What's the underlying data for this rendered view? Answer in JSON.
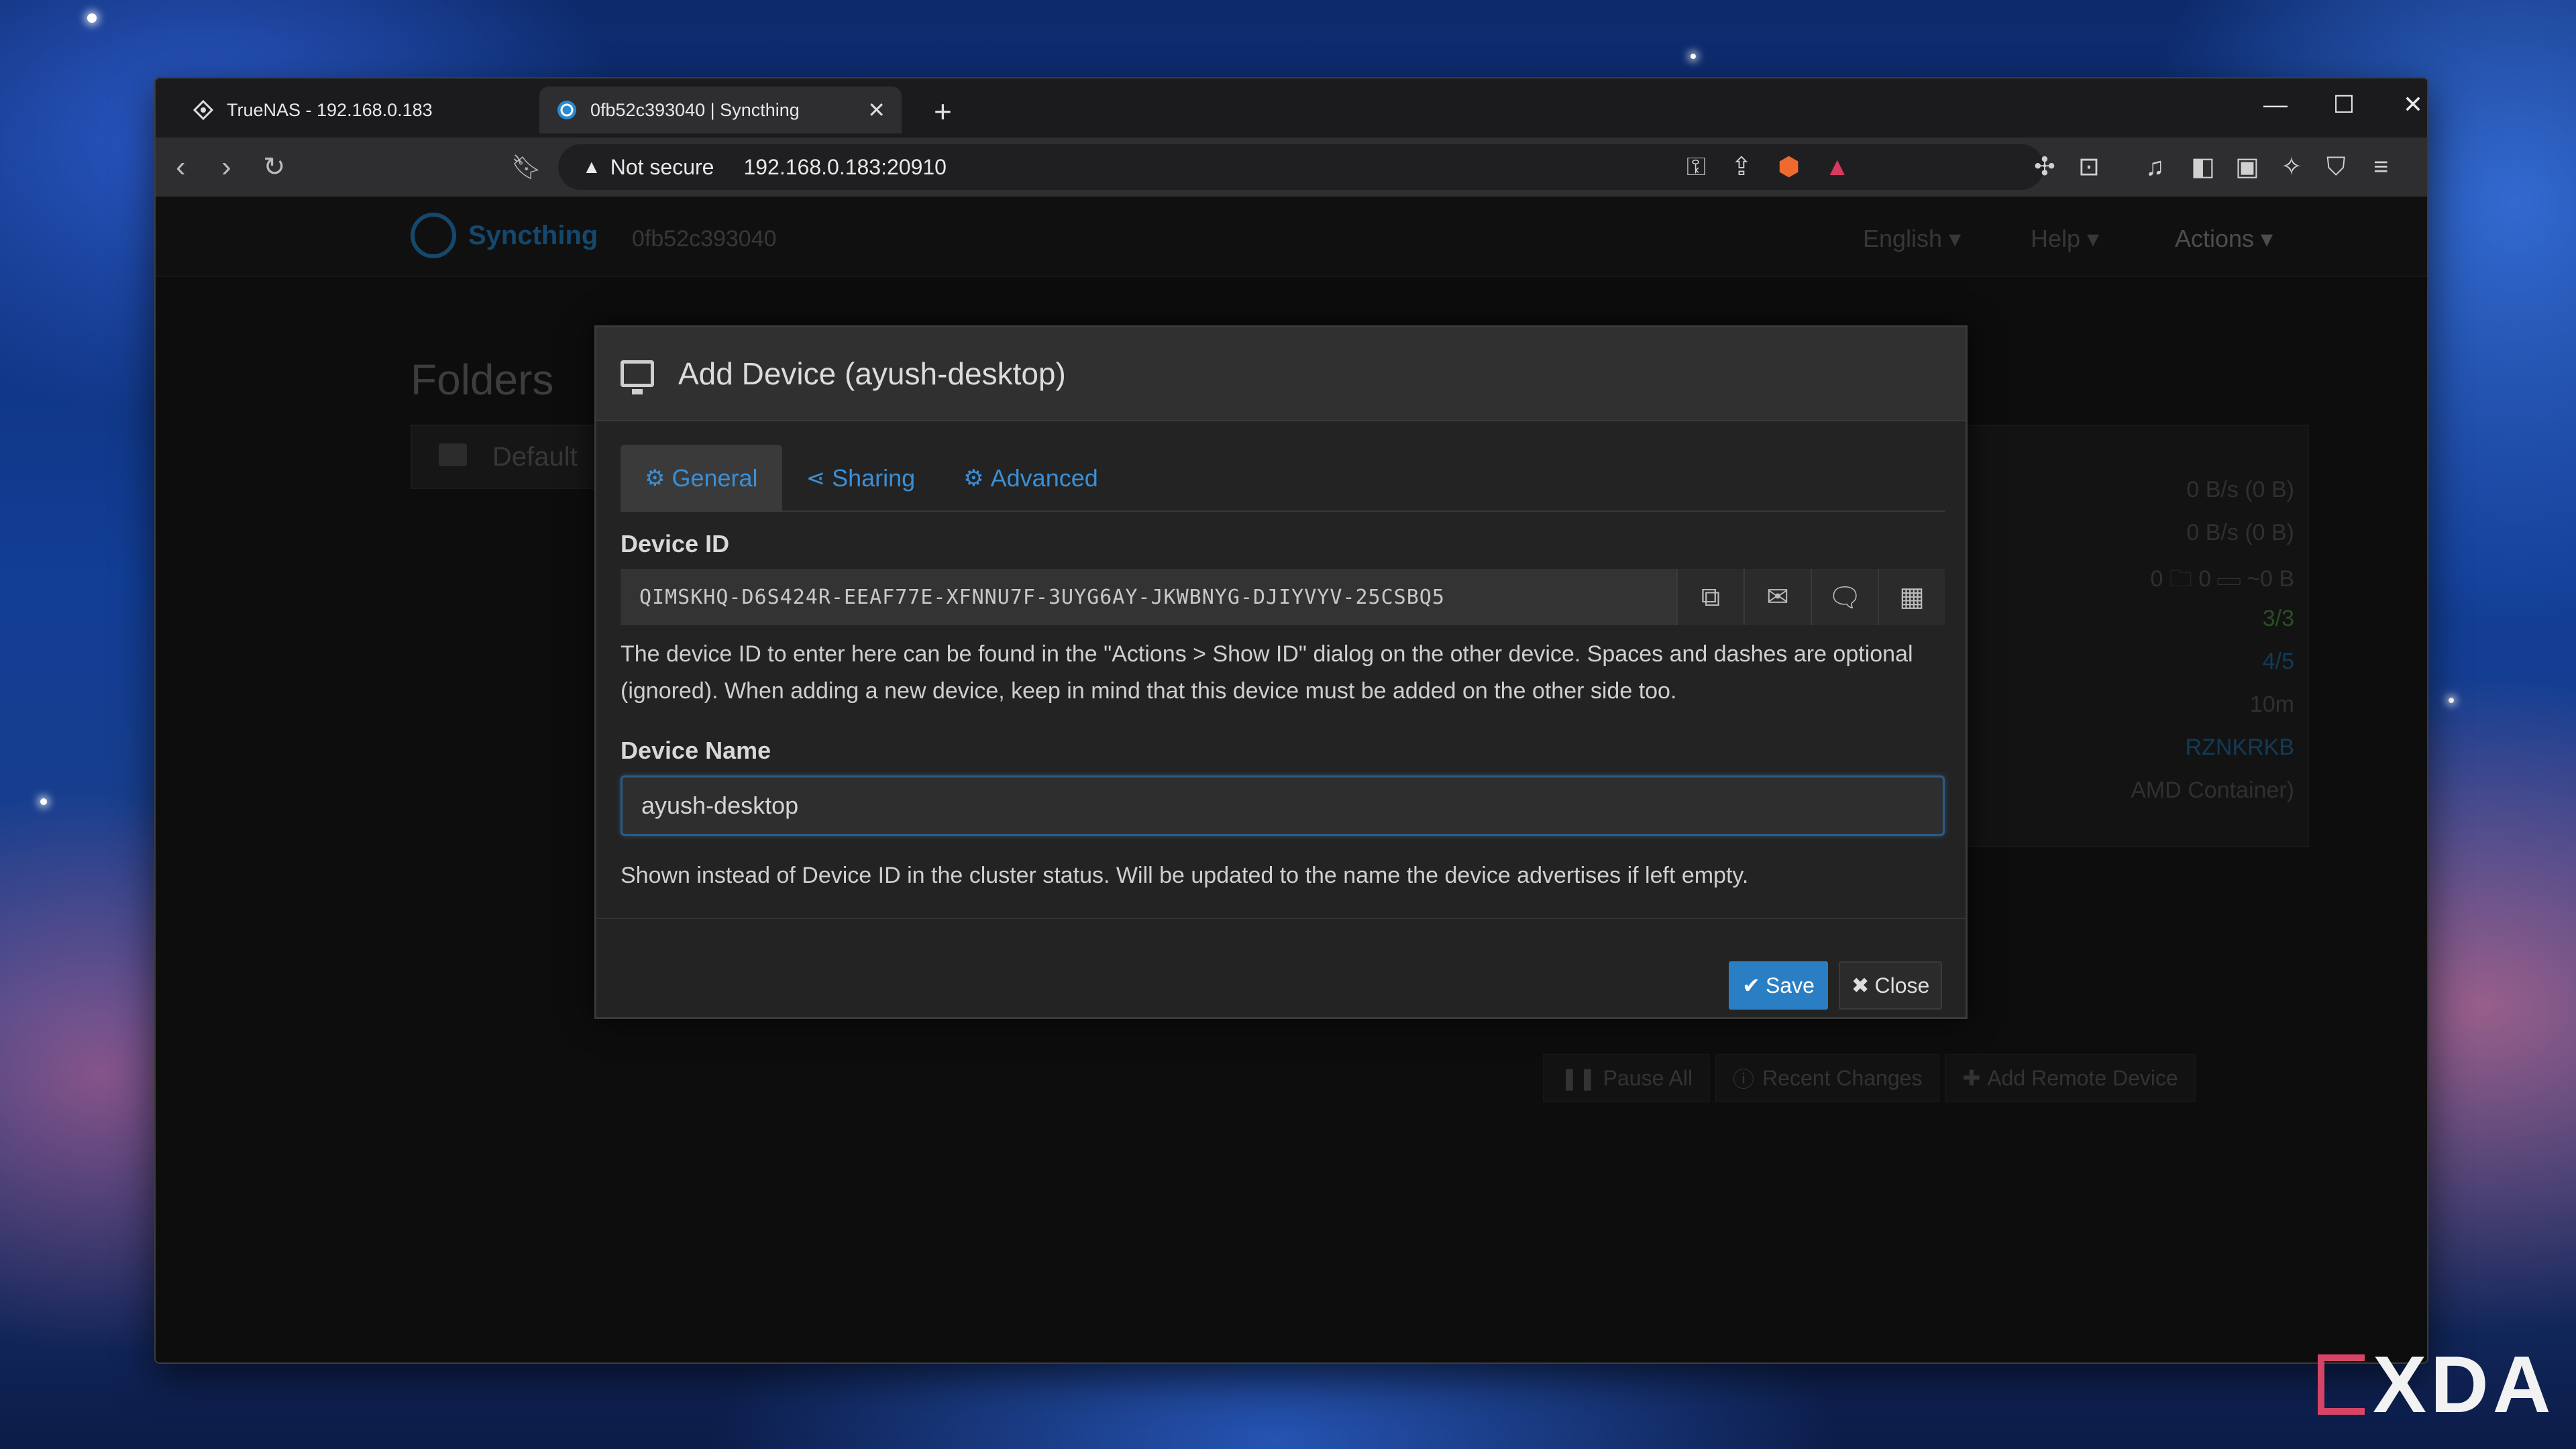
{
  "browser": {
    "tabs": [
      {
        "title": "TrueNAS - 192.168.0.183",
        "active": false
      },
      {
        "title": "0fb52c393040 | Syncthing",
        "active": true
      }
    ],
    "url": {
      "security_label": "Not secure",
      "address": "192.168.0.183:20910"
    }
  },
  "syncthing": {
    "brand": "Syncthing",
    "device_id_short": "0fb52c393040",
    "nav": {
      "language": "English ▾",
      "help": "Help ▾",
      "actions": "Actions ▾"
    },
    "folders_title": "Folders",
    "folder_name": "Default",
    "device_rows": [
      "0 B/s (0 B)",
      "0 B/s (0 B)",
      "0  🗀 0  ▭ ~0 B",
      "3/3",
      "4/5",
      "10m",
      "RZNKRKB",
      "AMD Container)"
    ],
    "bottom_buttons": {
      "pause_all": "Pause All",
      "recent_changes": "Recent Changes",
      "add_remote_device": "Add Remote Device"
    }
  },
  "modal": {
    "title": "Add Device (ayush-desktop)",
    "tabs": {
      "general": "General",
      "sharing": "Sharing",
      "advanced": "Advanced"
    },
    "device_id_label": "Device ID",
    "device_id_value": "QIMSKHQ-D6S424R-EEAF77E-XFNNU7F-3UYG6AY-JKWBNYG-DJIYVYV-25CSBQ5",
    "device_id_help": "The device ID to enter here can be found in the \"Actions > Show ID\" dialog on the other device. Spaces and dashes are optional (ignored). When adding a new device, keep in mind that this device must be added on the other side too.",
    "device_name_label": "Device Name",
    "device_name_value": "ayush-desktop",
    "device_name_help": "Shown instead of Device ID in the cluster status. Will be updated to the name the device advertises if left empty.",
    "save_label": "Save",
    "close_label": "Close"
  },
  "watermark": "XDA",
  "colors": {
    "accent": "#2a7fc4",
    "link": "#3b8fd6",
    "modal_bg": "#232323",
    "page_bg": "#141414"
  }
}
